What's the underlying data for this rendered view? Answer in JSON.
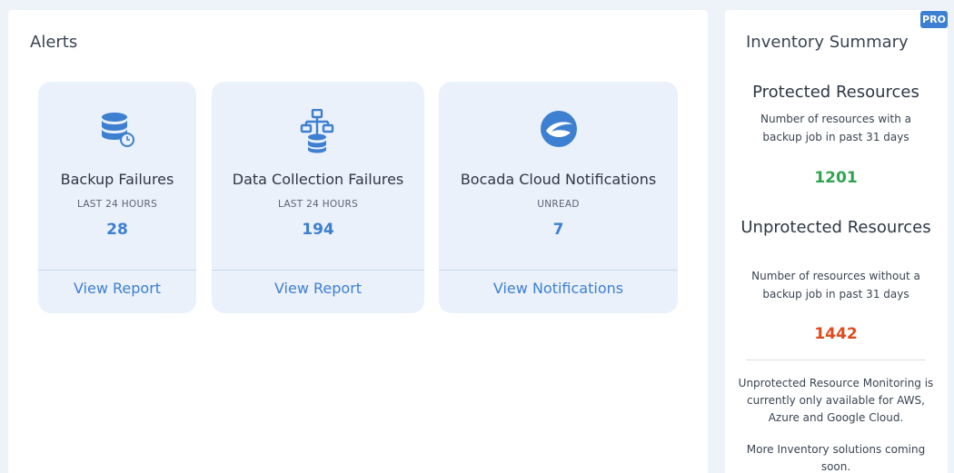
{
  "alerts": {
    "title": "Alerts",
    "cards": [
      {
        "icon": "database-icon",
        "title": "Backup Failures",
        "subtitle": "LAST 24 HOURS",
        "count": "28",
        "link": "View Report"
      },
      {
        "icon": "network-database-icon",
        "title": "Data Collection Failures",
        "subtitle": "LAST 24 HOURS",
        "count": "194",
        "link": "View Report"
      },
      {
        "icon": "bocada-logo-icon",
        "title": "Bocada Cloud Notifications",
        "subtitle": "UNREAD",
        "count": "7",
        "link": "View Notifications"
      }
    ]
  },
  "inventory": {
    "title": "Inventory Summary",
    "badge": "PRO",
    "protected": {
      "title": "Protected Resources",
      "description": "Number of resources with a backup job in past 31 days",
      "count": "1201"
    },
    "unprotected": {
      "title": "Unprotected Resources",
      "description": "Number of resources without a backup job in past 31 days",
      "count": "1442"
    },
    "note1": "Unprotected Resource Monitoring is currently only available for AWS, Azure and Google Cloud.",
    "note2": "More Inventory solutions coming soon."
  },
  "colors": {
    "accent": "#3d7fd0",
    "protected": "#2fa44f",
    "unprotected": "#e24a1b",
    "card_bg": "#eaf1fb"
  }
}
